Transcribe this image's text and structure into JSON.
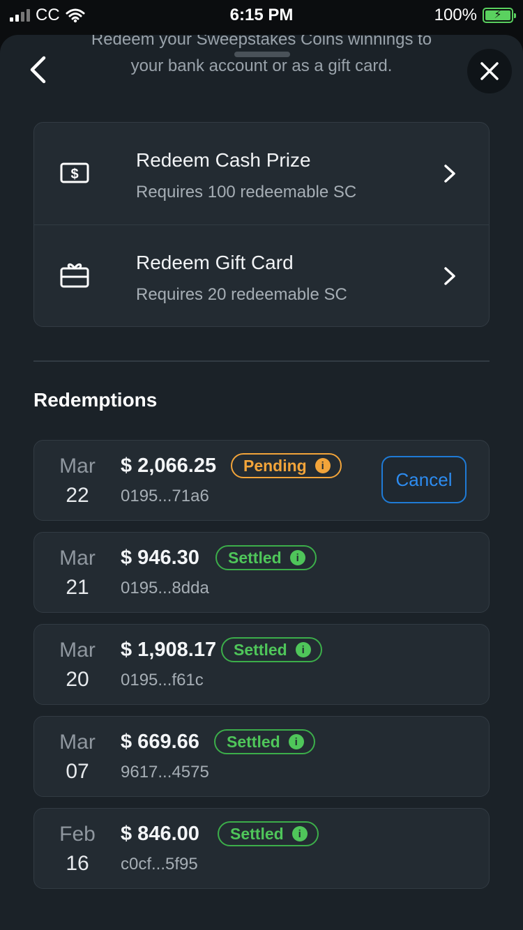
{
  "status_bar": {
    "carrier": "CC",
    "time": "6:15 PM",
    "battery": "100%"
  },
  "header": {
    "subtitle_line1": "Redeem your Sweepstakes Coins winnings to",
    "subtitle_line2": "your bank account or as a gift card."
  },
  "options": [
    {
      "title": "Redeem Cash Prize",
      "subtitle": "Requires 100 redeemable SC",
      "icon": "cash-icon"
    },
    {
      "title": "Redeem Gift Card",
      "subtitle": "Requires 20 redeemable SC",
      "icon": "gift-card-icon"
    }
  ],
  "redemptions": {
    "title": "Redemptions",
    "cancel_label": "Cancel",
    "items": [
      {
        "month": "Mar",
        "day": "22",
        "amount": "$ 2,066.25",
        "status": "Pending",
        "id": "0195...71a6"
      },
      {
        "month": "Mar",
        "day": "21",
        "amount": "$ 946.30",
        "status": "Settled",
        "id": "0195...8dda"
      },
      {
        "month": "Mar",
        "day": "20",
        "amount": "$ 1,908.17",
        "status": "Settled",
        "id": "0195...f61c"
      },
      {
        "month": "Mar",
        "day": "07",
        "amount": "$ 669.66",
        "status": "Settled",
        "id": "9617...4575"
      },
      {
        "month": "Feb",
        "day": "16",
        "amount": "$ 846.00",
        "status": "Settled",
        "id": "c0cf...5f95"
      }
    ]
  },
  "colors": {
    "pending": "#f2a43a",
    "settled": "#4fc65a",
    "accent": "#2d8cf0",
    "sheet": "#1b2228"
  }
}
